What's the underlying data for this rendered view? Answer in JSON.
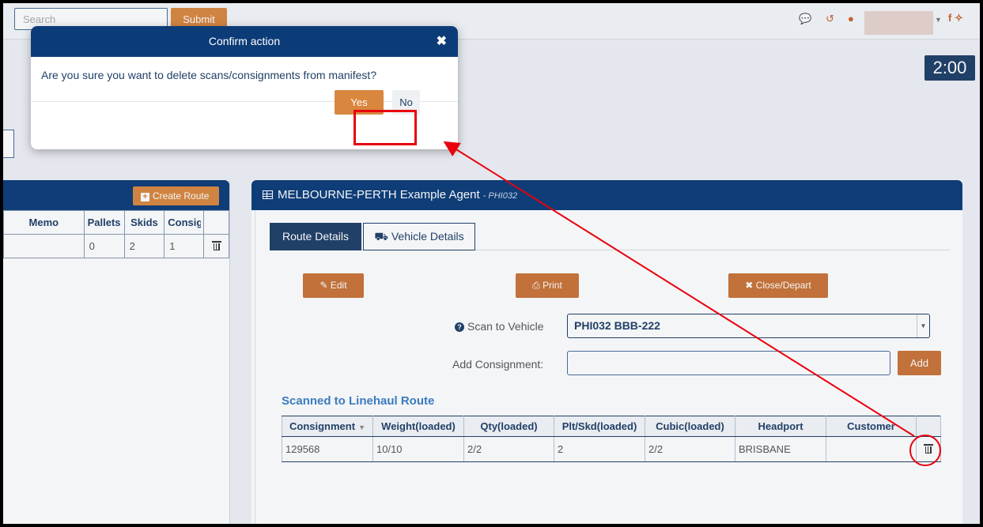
{
  "topbar": {
    "search_placeholder": "Search",
    "submit_label": "Submit",
    "social": "f"
  },
  "timer": "2:00",
  "left_panel": {
    "create_route_label": "Create Route",
    "columns": [
      "Memo",
      "Pallets",
      "Skids",
      "Consig"
    ],
    "row": {
      "memo": "",
      "pallets": "0",
      "skids": "2",
      "consig": "1"
    }
  },
  "right_panel": {
    "title": "MELBOURNE-PERTH Example Agent",
    "code": "- PHI032",
    "tabs": {
      "route_details": "Route Details",
      "vehicle_details": "Vehicle Details"
    },
    "buttons": {
      "edit": "Edit",
      "print": "Print",
      "close_depart": "Close/Depart",
      "add": "Add"
    },
    "scan_label": "Scan to Vehicle",
    "scan_value": "PHI032 BBB-222",
    "add_consignment_label": "Add Consignment:",
    "scanned_title": "Scanned to Linehaul Route",
    "table": {
      "columns": [
        "Consignment",
        "Weight(loaded)",
        "Qty(loaded)",
        "Plt/Skd(loaded)",
        "Cubic(loaded)",
        "Headport",
        "Customer"
      ],
      "rows": [
        {
          "consignment": "129568",
          "weight": "10/10",
          "qty": "2/2",
          "plt_skd": "2",
          "cubic": "2/2",
          "headport": "BRISBANE",
          "customer": ""
        }
      ]
    }
  },
  "modal": {
    "title": "Confirm action",
    "message": "Are you sure you want to delete scans/consignments from manifest?",
    "yes_label": "Yes",
    "no_label": "No"
  },
  "colors": {
    "navy": "#0c3c78",
    "orange": "#d9873e",
    "annotation_red": "#e8000c"
  }
}
